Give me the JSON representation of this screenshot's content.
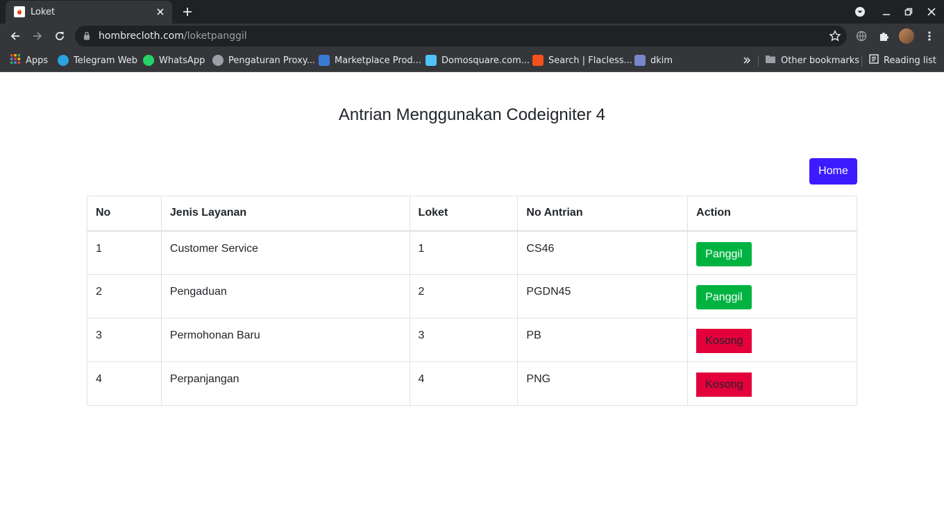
{
  "browser": {
    "tab_title": "Loket",
    "url_host": "hombrecloth.com",
    "url_path": "/loketpanggil",
    "bookmarks": [
      {
        "label": "Apps",
        "color": "#ea4335"
      },
      {
        "label": "Telegram Web",
        "color": "#2aa3e0"
      },
      {
        "label": "WhatsApp",
        "color": "#25d366"
      },
      {
        "label": "Pengaturan Proxy...",
        "color": "#9aa0a6"
      },
      {
        "label": "Marketplace Prod...",
        "color": "#3a7bd5"
      },
      {
        "label": "Domosquare.com...",
        "color": "#4fc3f7"
      },
      {
        "label": "Search | Flacless...",
        "color": "#f4511e"
      },
      {
        "label": "dkim",
        "color": "#7986cb"
      }
    ],
    "other_bookmarks": "Other bookmarks",
    "reading_list": "Reading list"
  },
  "page": {
    "title": "Antrian Menggunakan Codeigniter 4",
    "home_button": "Home",
    "table": {
      "headers": [
        "No",
        "Jenis Layanan",
        "Loket",
        "No Antrian",
        "Action"
      ],
      "rows": [
        {
          "no": "1",
          "service": "Customer Service",
          "counter": "1",
          "queue_no": "CS46",
          "action": "Panggil",
          "action_type": "call"
        },
        {
          "no": "2",
          "service": "Pengaduan",
          "counter": "2",
          "queue_no": "PGDN45",
          "action": "Panggil",
          "action_type": "call"
        },
        {
          "no": "3",
          "service": "Permohonan Baru",
          "counter": "3",
          "queue_no": "PB",
          "action": "Kosong",
          "action_type": "empty"
        },
        {
          "no": "4",
          "service": "Perpanjangan",
          "counter": "4",
          "queue_no": "PNG",
          "action": "Kosong",
          "action_type": "empty"
        }
      ]
    }
  },
  "colors": {
    "home_button": "#3d1bff",
    "call_button": "#00b341",
    "empty_button": "#e3003b"
  }
}
